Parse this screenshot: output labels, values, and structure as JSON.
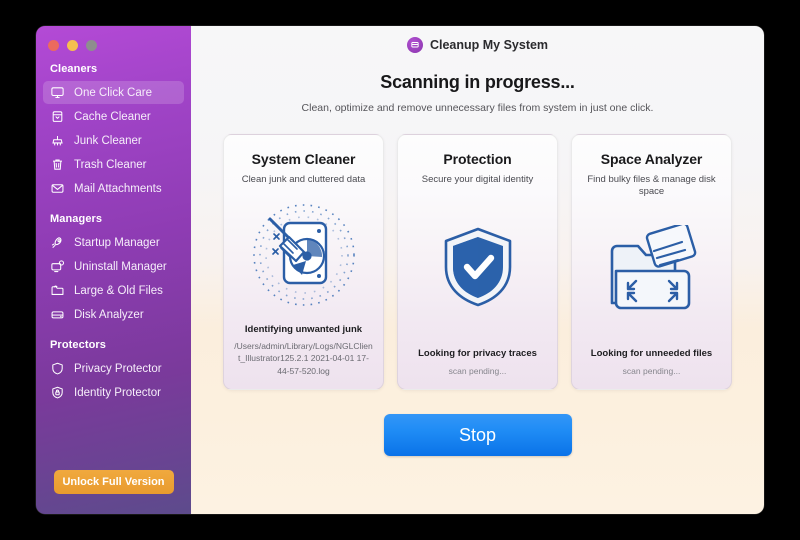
{
  "window": {
    "traffic_lights": [
      "close",
      "minimize",
      "zoom"
    ]
  },
  "sidebar": {
    "sections": [
      {
        "title": "Cleaners",
        "items": [
          {
            "label": "One Click Care",
            "icon": "monitor-icon",
            "active": true
          },
          {
            "label": "Cache Cleaner",
            "icon": "cache-icon",
            "active": false
          },
          {
            "label": "Junk Cleaner",
            "icon": "broom-icon",
            "active": false
          },
          {
            "label": "Trash Cleaner",
            "icon": "trash-icon",
            "active": false
          },
          {
            "label": "Mail Attachments",
            "icon": "mail-icon",
            "active": false
          }
        ]
      },
      {
        "title": "Managers",
        "items": [
          {
            "label": "Startup Manager",
            "icon": "rocket-icon",
            "active": false
          },
          {
            "label": "Uninstall Manager",
            "icon": "uninstall-icon",
            "active": false
          },
          {
            "label": "Large & Old Files",
            "icon": "folder-icon",
            "active": false
          },
          {
            "label": "Disk Analyzer",
            "icon": "disk-icon",
            "active": false
          }
        ]
      },
      {
        "title": "Protectors",
        "items": [
          {
            "label": "Privacy Protector",
            "icon": "shield-icon",
            "active": false
          },
          {
            "label": "Identity Protector",
            "icon": "lock-icon",
            "active": false
          }
        ]
      }
    ],
    "unlock_button": "Unlock Full Version"
  },
  "header": {
    "app_title": "Cleanup My System",
    "brand_icon": "cleanup-logo-icon"
  },
  "main": {
    "title": "Scanning in progress...",
    "subtitle": "Clean, optimize and remove unnecessary files from system in just one click.",
    "stop_button": "Stop",
    "cards": [
      {
        "title": "System Cleaner",
        "subtitle": "Clean junk and cluttered data",
        "icon": "disk-broom-icon",
        "status": "Identifying unwanted junk",
        "detail": "/Users/admin/Library/Logs/NGLClient_Illustrator125.2.1 2021-04-01 17-44-57-520.log"
      },
      {
        "title": "Protection",
        "subtitle": "Secure your digital identity",
        "icon": "shield-check-icon",
        "status": "Looking for privacy traces",
        "detail": "scan pending..."
      },
      {
        "title": "Space Analyzer",
        "subtitle": "Find bulky files & manage disk space",
        "icon": "folder-expand-icon",
        "status": "Looking for unneeded files",
        "detail": "scan pending..."
      }
    ]
  },
  "colors": {
    "sidebar_top": "#b44ad6",
    "sidebar_bottom": "#5d4b8c",
    "unlock_accent": "#e99b2e",
    "stop_accent": "#1f8cf5",
    "art_blue": "#2b5ea6"
  }
}
